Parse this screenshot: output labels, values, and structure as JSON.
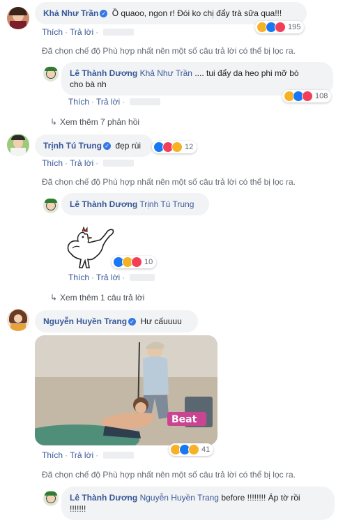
{
  "comment1": {
    "name": "Khả Như Trần",
    "text": "Ồ quaoo, ngon r! Đói ko chị đẩy trà sữa qua!!!",
    "like": "Thích",
    "reply": "Trả lời",
    "reaction_count": "195"
  },
  "filter_note": "Đã chọn chế độ Phù hợp nhất nên một số câu trả lời có thể bị lọc ra.",
  "reply1": {
    "name": "Lê Thành Dương",
    "tag": "Khả Như Trần",
    "text_line1": ".... tui đẩy da heo phi mỡ bò",
    "text_line2": "cho bà nh",
    "like": "Thích",
    "reply": "Trả lời",
    "reaction_count": "108"
  },
  "more1": "Xem thêm 7 phản hồi",
  "comment2": {
    "name": "Trịnh Tú Trung",
    "text": "đẹp rùi",
    "like": "Thích",
    "reply": "Trả lời",
    "reaction_count": "12"
  },
  "reply2": {
    "name": "Lê Thành Dương",
    "tag": "Trịnh Tú Trung",
    "like": "Thích",
    "reply": "Trả lời",
    "reaction_count": "10"
  },
  "more2": "Xem thêm 1 câu trả lời",
  "comment3": {
    "name": "Nguyễn Huyền Trang",
    "text": "Hư cấuuuu",
    "like": "Thích",
    "reply": "Trả lời",
    "reaction_count": "41"
  },
  "reply3": {
    "name": "Lê Thành Dương",
    "tag": "Nguyễn Huyền Trang",
    "text_line1": "before !!!!!!!! Áp tờ rồi",
    "text_line2": "!!!!!!!"
  },
  "colors": {
    "link": "#385898",
    "bubble": "#f2f3f5",
    "meta": "#606770"
  }
}
